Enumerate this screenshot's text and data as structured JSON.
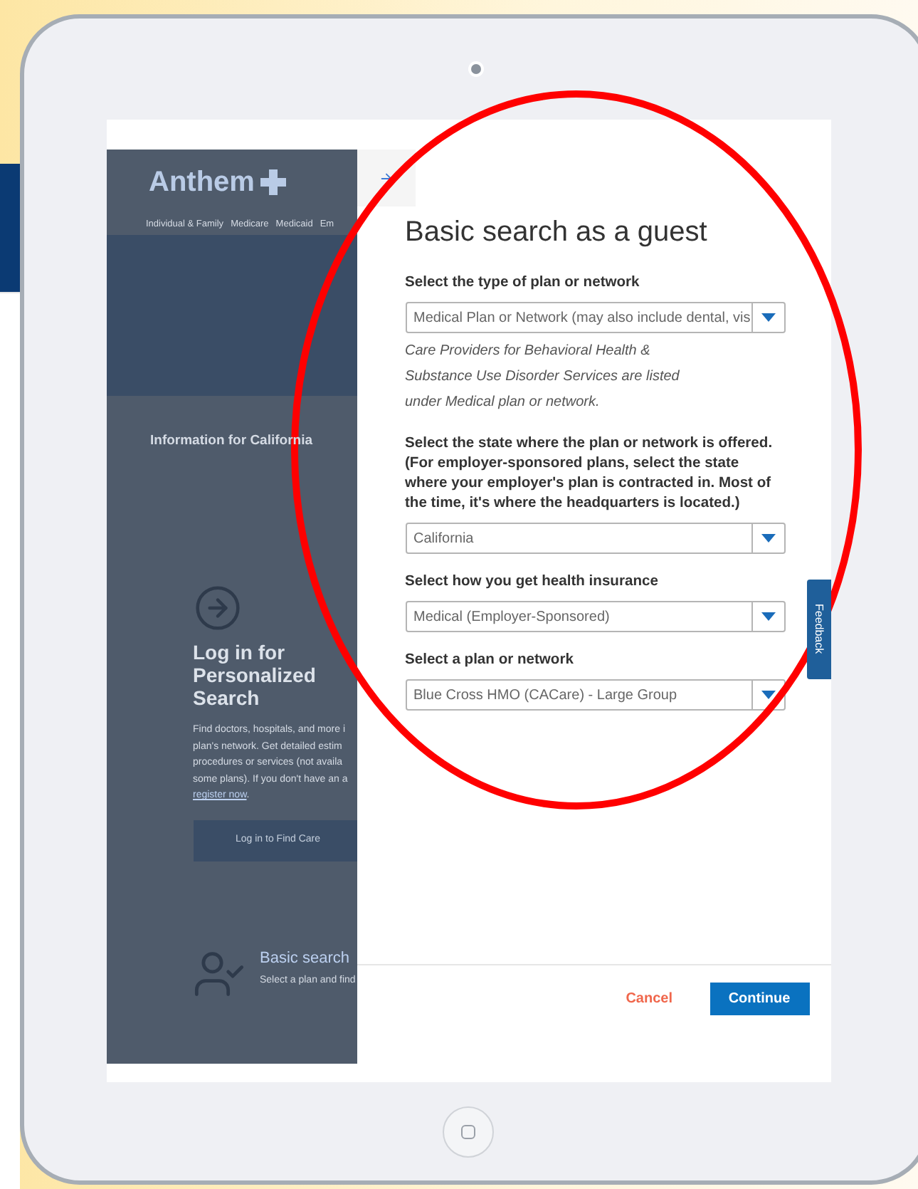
{
  "background_page": {
    "logo": "Anthem",
    "nav": [
      "Individual & Family",
      "Medicare",
      "Medicaid",
      "Em"
    ],
    "info_heading": "Information for California",
    "login": {
      "title": "Log in for Personalized Search",
      "description_lines": [
        "Find doctors, hospitals, and more i",
        "plan's network. Get detailed estim",
        "procedures or services (not availa",
        "some plans). If you don't have an a"
      ],
      "link": "register now",
      "link_suffix": ".",
      "button": "Log in to Find Care"
    },
    "basic_search": {
      "title": "Basic search",
      "subtitle": "Select a plan and find"
    }
  },
  "drawer": {
    "title": "Basic search as a guest",
    "fields": [
      {
        "label": "Select the type of plan or network",
        "value": "Medical Plan or Network (may also include dental, vis",
        "note": "Care Providers for Behavioral Health & Substance Use Disorder Services are listed under Medical plan or network."
      },
      {
        "label": "Select the state where the plan or network is offered. (For employer-sponsored plans, select the state where your employer's plan is contracted in. Most of the time, it's where the headquarters is located.)",
        "value": "California"
      },
      {
        "label": "Select how you get health insurance",
        "value": "Medical (Employer-Sponsored)"
      },
      {
        "label": "Select a plan or network",
        "value": "Blue Cross HMO (CACare) - Large Group"
      }
    ],
    "cancel": "Cancel",
    "continue": "Continue"
  },
  "feedback_tab": "Feedback"
}
